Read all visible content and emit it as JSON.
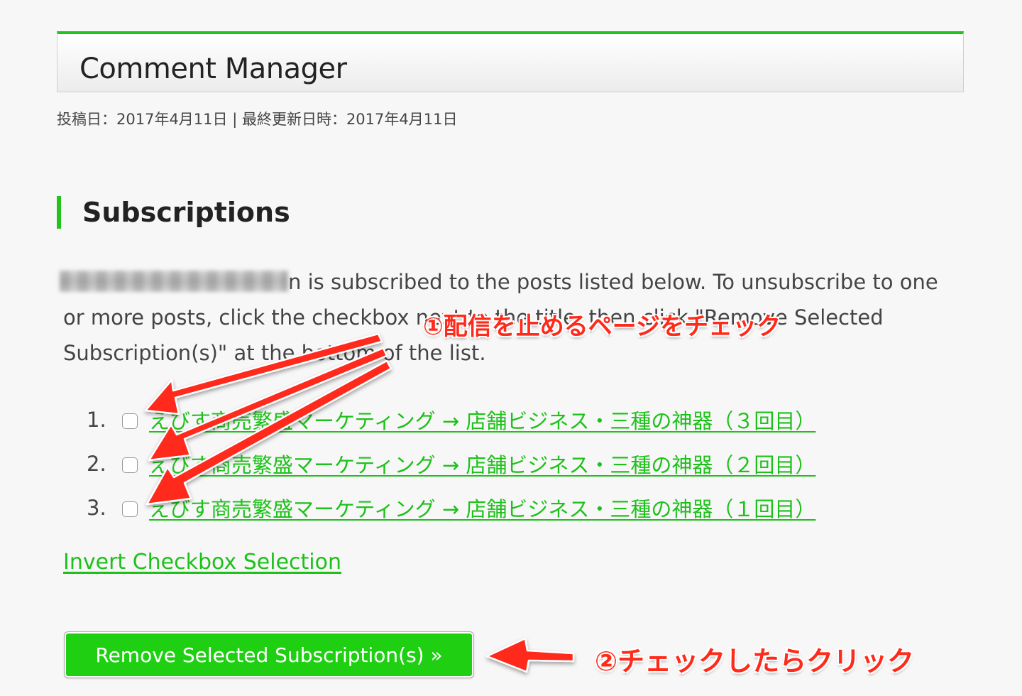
{
  "header": {
    "title": "Comment Manager",
    "meta": "投稿日：2017年4月11日 | 最終更新日時：2017年4月11日"
  },
  "section": {
    "heading": "Subscriptions"
  },
  "intro": {
    "text_after_email": "n is subscribed to the posts listed below. To unsubscribe to one or more posts, click the checkbox next to the title, then click \"Remove Selected Subscription(s)\" at the bottom of the list."
  },
  "subscriptions": [
    {
      "number": "1.",
      "title": "えびす商売繁盛マーケティング → 店舗ビジネス・三種の神器（３回目）",
      "checked": false
    },
    {
      "number": "2.",
      "title": "えびす商売繁盛マーケティング → 店舗ビジネス・三種の神器（２回目）",
      "checked": false
    },
    {
      "number": "3.",
      "title": "えびす商売繁盛マーケティング → 店舗ビジネス・三種の神器（１回目）",
      "checked": false
    }
  ],
  "invert_link": "Invert Checkbox Selection",
  "remove_button": "Remove Selected Subscription(s) »",
  "annotations": {
    "step1": "①配信を止めるページをチェック",
    "step2": "②チェックしたらクリック"
  },
  "colors": {
    "accent_green": "#22c31b",
    "link_green": "#1dc11a",
    "button_green": "#1fd012",
    "annotation_red": "#ff2a1a"
  }
}
